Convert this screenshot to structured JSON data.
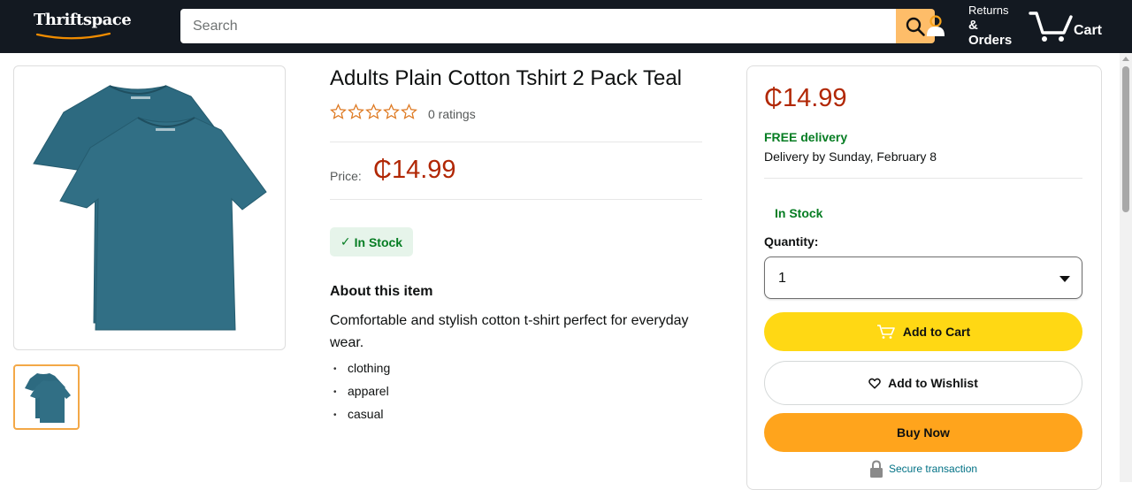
{
  "header": {
    "logo_text": "Thriftspace",
    "search_placeholder": "Search",
    "returns_line1": "Returns",
    "returns_line2": "&",
    "returns_line3": "Orders",
    "cart_label": "Cart",
    "colors": {
      "bar": "#131921",
      "search_button": "#febd69"
    }
  },
  "gallery": {
    "main_image_icon": "teal-tshirt-two-pack-image",
    "thumbnails": [
      {
        "icon": "teal-tshirt-thumbnail",
        "selected": true
      }
    ]
  },
  "product": {
    "title": "Adults Plain Cotton Tshirt 2 Pack Teal",
    "rating_stars": 0,
    "ratings_text": "0 ratings",
    "price_label": "Price:",
    "price": "₵14.99",
    "stock_badge": "In Stock",
    "about_title": "About this item",
    "description": "Comfortable and stylish cotton t-shirt perfect for everyday wear.",
    "tags": [
      "clothing",
      "apparel",
      "casual"
    ]
  },
  "buybox": {
    "price": "₵14.99",
    "free_delivery": "FREE delivery",
    "delivery_date": "Delivery by Sunday, February 8",
    "stock": "In Stock",
    "quantity_label": "Quantity:",
    "quantity_value": "1",
    "add_to_cart": "Add to Cart",
    "add_to_wishlist": "Add to Wishlist",
    "buy_now": "Buy Now",
    "secure": "Secure transaction",
    "colors": {
      "price": "#b12704",
      "in_stock": "#067d23",
      "add_to_cart": "#ffd814",
      "buy_now": "#ffa41c",
      "link": "#007185"
    }
  }
}
